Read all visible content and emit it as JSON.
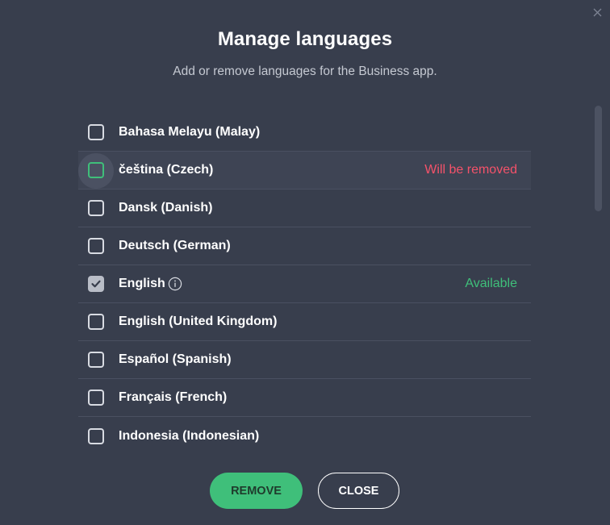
{
  "dialog": {
    "title": "Manage languages",
    "subtitle": "Add or remove languages for the Business app.",
    "close_icon": "close-icon"
  },
  "languages": [
    {
      "label": "Bahasa Melayu (Malay)",
      "checked": false,
      "status": ""
    },
    {
      "label": "čeština (Czech)",
      "checked": false,
      "status": "Will be removed"
    },
    {
      "label": "Dansk (Danish)",
      "checked": false,
      "status": ""
    },
    {
      "label": "Deutsch (German)",
      "checked": false,
      "status": ""
    },
    {
      "label": "English",
      "checked": true,
      "status": "Available"
    },
    {
      "label": "English (United Kingdom)",
      "checked": false,
      "status": ""
    },
    {
      "label": "Español (Spanish)",
      "checked": false,
      "status": ""
    },
    {
      "label": "Français (French)",
      "checked": false,
      "status": ""
    },
    {
      "label": "Indonesia (Indonesian)",
      "checked": false,
      "status": ""
    }
  ],
  "buttons": {
    "remove_label": "REMOVE",
    "close_label": "CLOSE"
  },
  "colors": {
    "background": "#383e4d",
    "accent_green": "#3fbf7a",
    "removed_red": "#f5526a"
  }
}
